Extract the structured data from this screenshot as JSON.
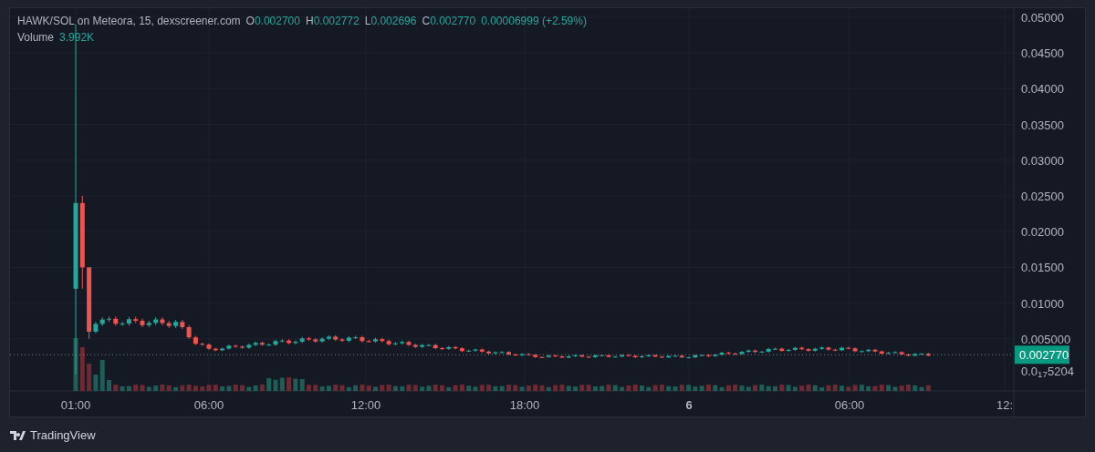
{
  "legend": {
    "title": "HAWK/SOL on Meteora, 15, dexscreener.com",
    "ohlc": [
      {
        "label": "O",
        "value": "0.002700"
      },
      {
        "label": "H",
        "value": "0.002772"
      },
      {
        "label": "L",
        "value": "0.002696"
      },
      {
        "label": "C",
        "value": "0.002770"
      }
    ],
    "change": "0.00006999 (+2.59%)",
    "volume": {
      "label": "Volume",
      "value": "3.992K"
    }
  },
  "price_axis": [
    "0.05000",
    "0.04500",
    "0.04000",
    "0.03500",
    "0.03000",
    "0.02500",
    "0.02000",
    "0.01500",
    "0.01000",
    "0.005000"
  ],
  "price_axis_min": "0.0$_{17}$5204",
  "current_price": "0.002770",
  "time_axis": [
    {
      "label": "01:00",
      "kind": "time"
    },
    {
      "label": "06:00",
      "kind": "time"
    },
    {
      "label": "12:00",
      "kind": "time"
    },
    {
      "label": "18:00",
      "kind": "time"
    },
    {
      "label": "6",
      "kind": "day"
    },
    {
      "label": "06:00",
      "kind": "time"
    },
    {
      "label": "12:",
      "kind": "time"
    }
  ],
  "footer": {
    "brand": "TradingView"
  }
}
